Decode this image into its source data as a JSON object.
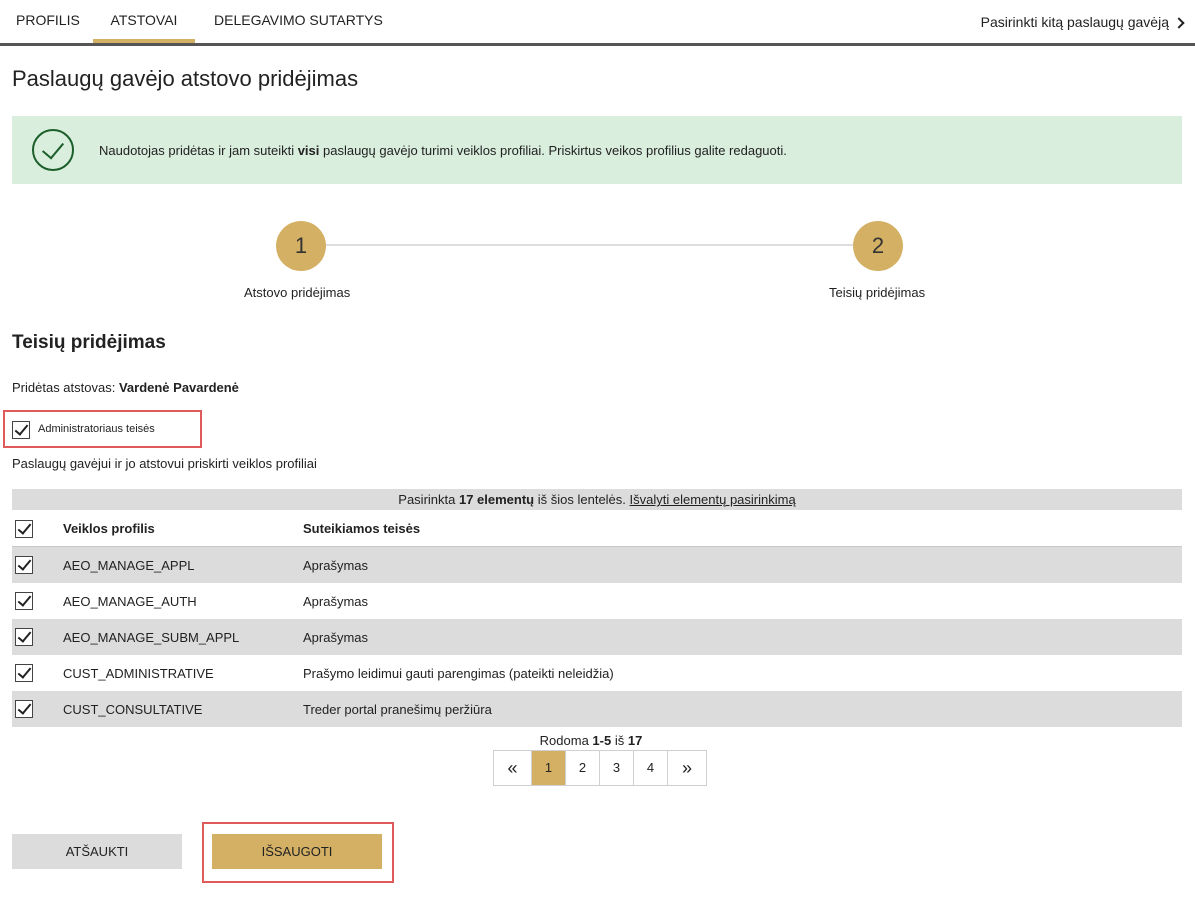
{
  "nav": {
    "tabs": [
      {
        "label": "PROFILIS"
      },
      {
        "label": "ATSTOVAI",
        "active": true
      },
      {
        "label": "DELEGAVIMO SUTARTYS"
      }
    ],
    "switch_link": "Pasirinkti kitą paslaugų gavėją"
  },
  "page": {
    "title": "Paslaugų gavėjo atstovo pridėjimas"
  },
  "alert": {
    "text_before": "Naudotojas pridėtas ir jam suteikti ",
    "text_bold": "visi",
    "text_after": " paslaugų gavėjo turimi veiklos profiliai. Priskirtus veikos profilius galite redaguoti."
  },
  "stepper": {
    "steps": [
      {
        "number": "1",
        "label": "Atstovo pridėjimas"
      },
      {
        "number": "2",
        "label": "Teisių pridėjimas"
      }
    ]
  },
  "section": {
    "title": "Teisių pridėjimas",
    "added_rep_label": "Pridėtas atstovas: ",
    "added_rep_name": "Vardenė Pavardenė",
    "admin_rights_label": "Administratoriaus teisės",
    "admin_rights_checked": true,
    "assigned_label": "Paslaugų gavėjui ir jo atstovui priskirti veiklos profiliai"
  },
  "selection": {
    "prefix": "Pasirinkta ",
    "count_bold": "17 elementų",
    "middle": " iš šios lentelės. ",
    "clear_link": "Išvalyti elementų pasirinkimą"
  },
  "table": {
    "headers": {
      "profile": "Veiklos profilis",
      "rights": "Suteikiamos teisės"
    },
    "rows": [
      {
        "profile": "AEO_MANAGE_APPL",
        "rights": "Aprašymas",
        "checked": true
      },
      {
        "profile": "AEO_MANAGE_AUTH",
        "rights": "Aprašymas",
        "checked": true
      },
      {
        "profile": "AEO_MANAGE_SUBM_APPL",
        "rights": "Aprašymas",
        "checked": true
      },
      {
        "profile": "CUST_ADMINISTRATIVE",
        "rights": "Prašymo leidimui gauti parengimas (pateikti neleidžia)",
        "checked": true
      },
      {
        "profile": "CUST_CONSULTATIVE",
        "rights": "Treder portal pranešimų peržiūra",
        "checked": true
      }
    ]
  },
  "paging": {
    "showing_prefix": "Rodoma ",
    "range": "1-5",
    "of": " iš ",
    "total": "17",
    "first": "«",
    "pages": [
      "1",
      "2",
      "3",
      "4"
    ],
    "active_page": "1",
    "last": "»"
  },
  "actions": {
    "cancel": "ATŠAUKTI",
    "save": "IŠSAUGOTI"
  },
  "colors": {
    "accent": "#d3b064",
    "success_bg": "#d9eedd",
    "success_icon": "#1b5e2a",
    "highlight_border": "#e05a5a",
    "row_shade": "#dcdcdc"
  }
}
